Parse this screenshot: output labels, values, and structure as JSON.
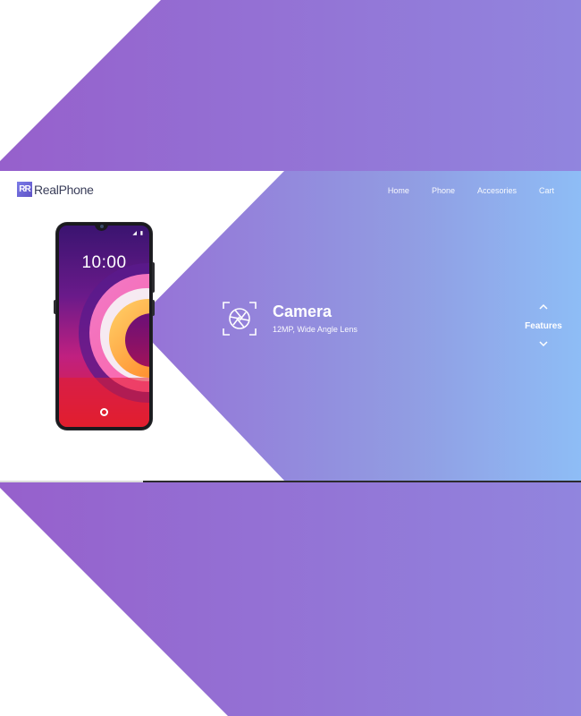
{
  "brand": {
    "logo_mark": "RR",
    "name": "RealPhone"
  },
  "nav": {
    "items": [
      "Home",
      "Phone",
      "Accesories",
      "Cart"
    ]
  },
  "phone": {
    "clock": "10:00",
    "status": "◢ ▮"
  },
  "feature": {
    "icon": "camera-aperture-icon",
    "title": "Camera",
    "subtitle": "12MP, Wide Angle Lens"
  },
  "features_nav": {
    "label": "Features",
    "up_icon": "chevron-up-icon",
    "down_icon": "chevron-down-icon"
  },
  "colors": {
    "gradient_start": "#9b5bd0",
    "gradient_end": "#8ebdf6",
    "band": "#9660cc"
  }
}
